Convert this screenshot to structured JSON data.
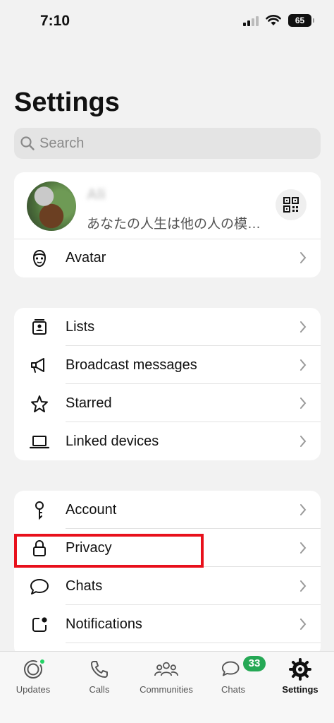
{
  "status_bar": {
    "time": "7:10",
    "battery": "65"
  },
  "page": {
    "title": "Settings"
  },
  "search": {
    "placeholder": "Search"
  },
  "profile": {
    "name": "Ali",
    "about": "あなたの人生は他の人の模…"
  },
  "section1": [
    {
      "label": "Avatar",
      "icon": "avatar-face-icon"
    }
  ],
  "section2": [
    {
      "label": "Lists",
      "icon": "lists-icon"
    },
    {
      "label": "Broadcast messages",
      "icon": "megaphone-icon"
    },
    {
      "label": "Starred",
      "icon": "star-icon"
    },
    {
      "label": "Linked devices",
      "icon": "laptop-icon"
    }
  ],
  "section3": [
    {
      "label": "Account",
      "icon": "key-icon"
    },
    {
      "label": "Privacy",
      "icon": "lock-icon"
    },
    {
      "label": "Chats",
      "icon": "chat-bubble-icon"
    },
    {
      "label": "Notifications",
      "icon": "notification-icon"
    }
  ],
  "tabbar": {
    "tabs": [
      {
        "label": "Updates",
        "icon": "updates-icon"
      },
      {
        "label": "Calls",
        "icon": "phone-icon"
      },
      {
        "label": "Communities",
        "icon": "communities-icon"
      },
      {
        "label": "Chats",
        "icon": "chats-icon",
        "badge": "33"
      },
      {
        "label": "Settings",
        "icon": "settings-gear-icon",
        "active": true
      }
    ]
  },
  "colors": {
    "accent_green": "#25a855",
    "highlight_red": "#e8101b",
    "background": "#f2f2f2"
  }
}
